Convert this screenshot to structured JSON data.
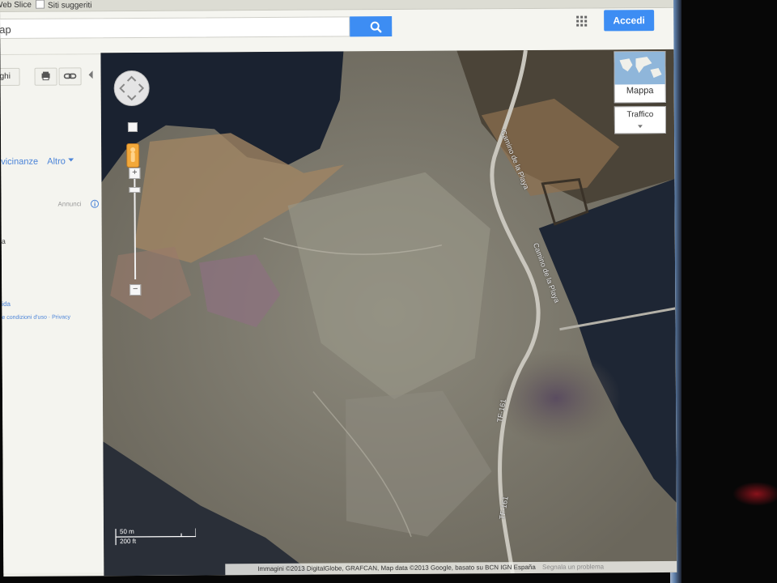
{
  "bookmarks": {
    "web_slice": "Web Slice",
    "suggested": "Siti suggeriti"
  },
  "search": {
    "value": "ap"
  },
  "header": {
    "signin_label": "Accedi"
  },
  "left_panel": {
    "places_button": "ghi",
    "nearby_label": "vicinanze",
    "more_label": "Altro",
    "ads_label": "Annunci",
    "fragment_a": "a",
    "help_link": "ida",
    "terms_link": "e condizioni d'uso",
    "separator": "·",
    "privacy_link": "Privacy"
  },
  "map": {
    "maptype_label": "Mappa",
    "traffic_label": "Traffico",
    "zoom_in": "+",
    "zoom_out": "−",
    "scale_metric": "50 m",
    "scale_imperial": "200 ft",
    "copyright": "Immagini ©2013 DigitalGlobe, GRAFCAN, Map data ©2013 Google, basato su BCN IGN España",
    "report_problem": "Segnala un problema",
    "road_labels": [
      "Camino de la Playa",
      "Camino de la Playa",
      "TF-161",
      "TF-161"
    ]
  },
  "colors": {
    "accent": "#3d8df3",
    "link": "#4b84d8"
  }
}
